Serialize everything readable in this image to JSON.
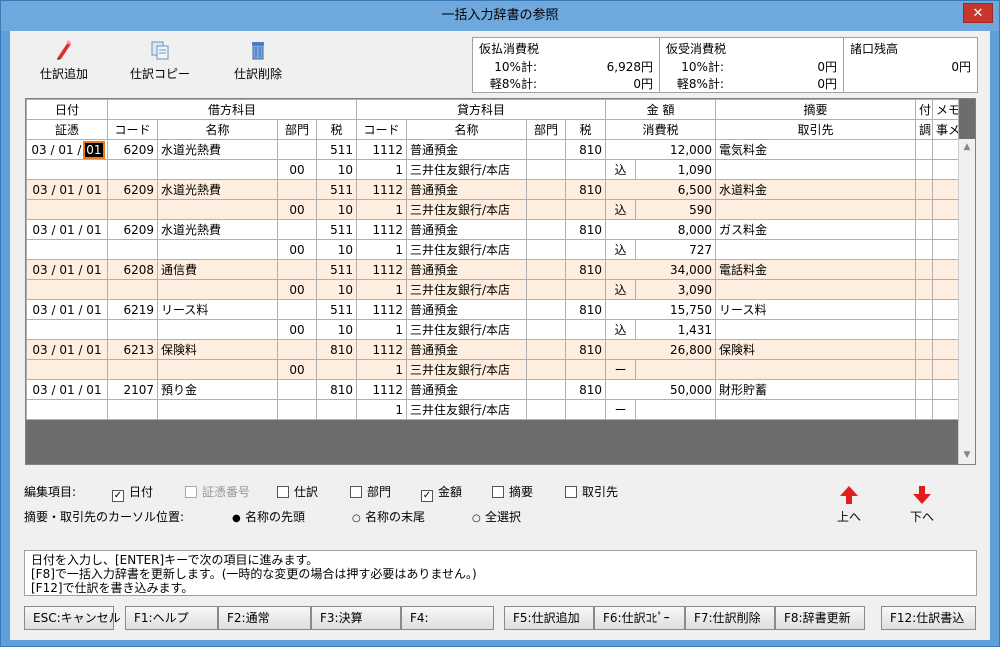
{
  "window": {
    "title": "一括入力辞書の参照",
    "close": "✕"
  },
  "toolbar": {
    "add": "仕訳追加",
    "copy": "仕訳コピー",
    "delete": "仕訳削除"
  },
  "summary": {
    "col1": {
      "title": "仮払消費税",
      "row1_label": "10%計:",
      "row1_value": "6,928円",
      "row2_label": "軽8%計:",
      "row2_value": "0円"
    },
    "col2": {
      "title": "仮受消費税",
      "row1_label": "10%計:",
      "row1_value": "0円",
      "row2_label": "軽8%計:",
      "row2_value": "0円"
    },
    "col3": {
      "title": "諸口残高",
      "value": "0円"
    }
  },
  "headers": {
    "row1": {
      "date": "日付",
      "debit": "借方科目",
      "credit": "貸方科目",
      "amount": "金 額",
      "summary": "摘要",
      "attach": "付",
      "memo": "メモ"
    },
    "row2": {
      "voucher": "証憑",
      "code": "コード",
      "name": "名称",
      "dept": "部門",
      "tax": "税",
      "code2": "コード",
      "name2": "名称",
      "dept2": "部門",
      "tax2": "税",
      "consumption": "消費税",
      "partner": "取引先",
      "adjust": "調",
      "memo2": "事メモ"
    }
  },
  "entries": [
    {
      "date_a": "03 / 01 / ",
      "date_b": "01",
      "d_code": "6209",
      "d_name": "水道光熱費",
      "d_dept": "",
      "d_tax": "511",
      "c_code": "1112",
      "c_name": "普通預金",
      "c_dept": "",
      "c_tax": "810",
      "amount": "12,000",
      "summary": "電気料金",
      "r2_d_dept": "00",
      "r2_d_tax": "10",
      "r2_c_code": "1",
      "r2_c_name": "三井住友銀行/本店",
      "r2_mark": "込",
      "r2_tax": "1,090"
    },
    {
      "date_a": "03 / 01 / 01",
      "d_code": "6209",
      "d_name": "水道光熱費",
      "d_dept": "",
      "d_tax": "511",
      "c_code": "1112",
      "c_name": "普通預金",
      "c_dept": "",
      "c_tax": "810",
      "amount": "6,500",
      "summary": "水道料金",
      "r2_d_dept": "00",
      "r2_d_tax": "10",
      "r2_c_code": "1",
      "r2_c_name": "三井住友銀行/本店",
      "r2_mark": "込",
      "r2_tax": "590"
    },
    {
      "date_a": "03 / 01 / 01",
      "d_code": "6209",
      "d_name": "水道光熱費",
      "d_dept": "",
      "d_tax": "511",
      "c_code": "1112",
      "c_name": "普通預金",
      "c_dept": "",
      "c_tax": "810",
      "amount": "8,000",
      "summary": "ガス料金",
      "r2_d_dept": "00",
      "r2_d_tax": "10",
      "r2_c_code": "1",
      "r2_c_name": "三井住友銀行/本店",
      "r2_mark": "込",
      "r2_tax": "727"
    },
    {
      "date_a": "03 / 01 / 01",
      "d_code": "6208",
      "d_name": "通信費",
      "d_dept": "",
      "d_tax": "511",
      "c_code": "1112",
      "c_name": "普通預金",
      "c_dept": "",
      "c_tax": "810",
      "amount": "34,000",
      "summary": "電話料金",
      "r2_d_dept": "00",
      "r2_d_tax": "10",
      "r2_c_code": "1",
      "r2_c_name": "三井住友銀行/本店",
      "r2_mark": "込",
      "r2_tax": "3,090"
    },
    {
      "date_a": "03 / 01 / 01",
      "d_code": "6219",
      "d_name": "リース料",
      "d_dept": "",
      "d_tax": "511",
      "c_code": "1112",
      "c_name": "普通預金",
      "c_dept": "",
      "c_tax": "810",
      "amount": "15,750",
      "summary": "リース料",
      "r2_d_dept": "00",
      "r2_d_tax": "10",
      "r2_c_code": "1",
      "r2_c_name": "三井住友銀行/本店",
      "r2_mark": "込",
      "r2_tax": "1,431"
    },
    {
      "date_a": "03 / 01 / 01",
      "d_code": "6213",
      "d_name": "保険料",
      "d_dept": "",
      "d_tax": "810",
      "c_code": "1112",
      "c_name": "普通預金",
      "c_dept": "",
      "c_tax": "810",
      "amount": "26,800",
      "summary": "保険料",
      "r2_d_dept": "00",
      "r2_d_tax": "",
      "r2_c_code": "1",
      "r2_c_name": "三井住友銀行/本店",
      "r2_mark": "ー",
      "r2_tax": ""
    },
    {
      "date_a": "03 / 01 / 01",
      "d_code": "2107",
      "d_name": "預り金",
      "d_dept": "",
      "d_tax": "810",
      "c_code": "1112",
      "c_name": "普通預金",
      "c_dept": "",
      "c_tax": "810",
      "amount": "50,000",
      "summary": "財形貯蓄",
      "r2_d_dept": "",
      "r2_d_tax": "",
      "r2_c_code": "1",
      "r2_c_name": "三井住友銀行/本店",
      "r2_mark": "ー",
      "r2_tax": ""
    }
  ],
  "edit": {
    "label": "編集項目:",
    "date": "日付",
    "voucher": "証憑番号",
    "journal": "仕訳",
    "dept": "部門",
    "amount": "金額",
    "summary": "摘要",
    "partner": "取引先",
    "check": "✓"
  },
  "cursor": {
    "label": "摘要・取引先のカーソル位置:",
    "head": "名称の先頭",
    "tail": "名称の末尾",
    "all": "全選択",
    "dot": "●"
  },
  "nav": {
    "up": "上へ",
    "down": "下へ"
  },
  "message": {
    "line1": "日付を入力し、[ENTER]キーで次の項目に進みます。",
    "line2": "[F8]で一括入力辞書を更新します。(一時的な変更の場合は押す必要はありません。)",
    "line3": "[F12]で仕訳を書き込みます。"
  },
  "fkeys": {
    "esc": "ESC:キャンセル",
    "f1": "F1:ヘルプ",
    "f2": "F2:通常",
    "f3": "F3:決算",
    "f4": "F4:",
    "f5": "F5:仕訳追加",
    "f6": "F6:仕訳ｺﾋﾟｰ",
    "f7": "F7:仕訳削除",
    "f8": "F8:辞書更新",
    "f12": "F12:仕訳書込"
  },
  "scroll": {
    "up": "▲",
    "down": "▼"
  }
}
